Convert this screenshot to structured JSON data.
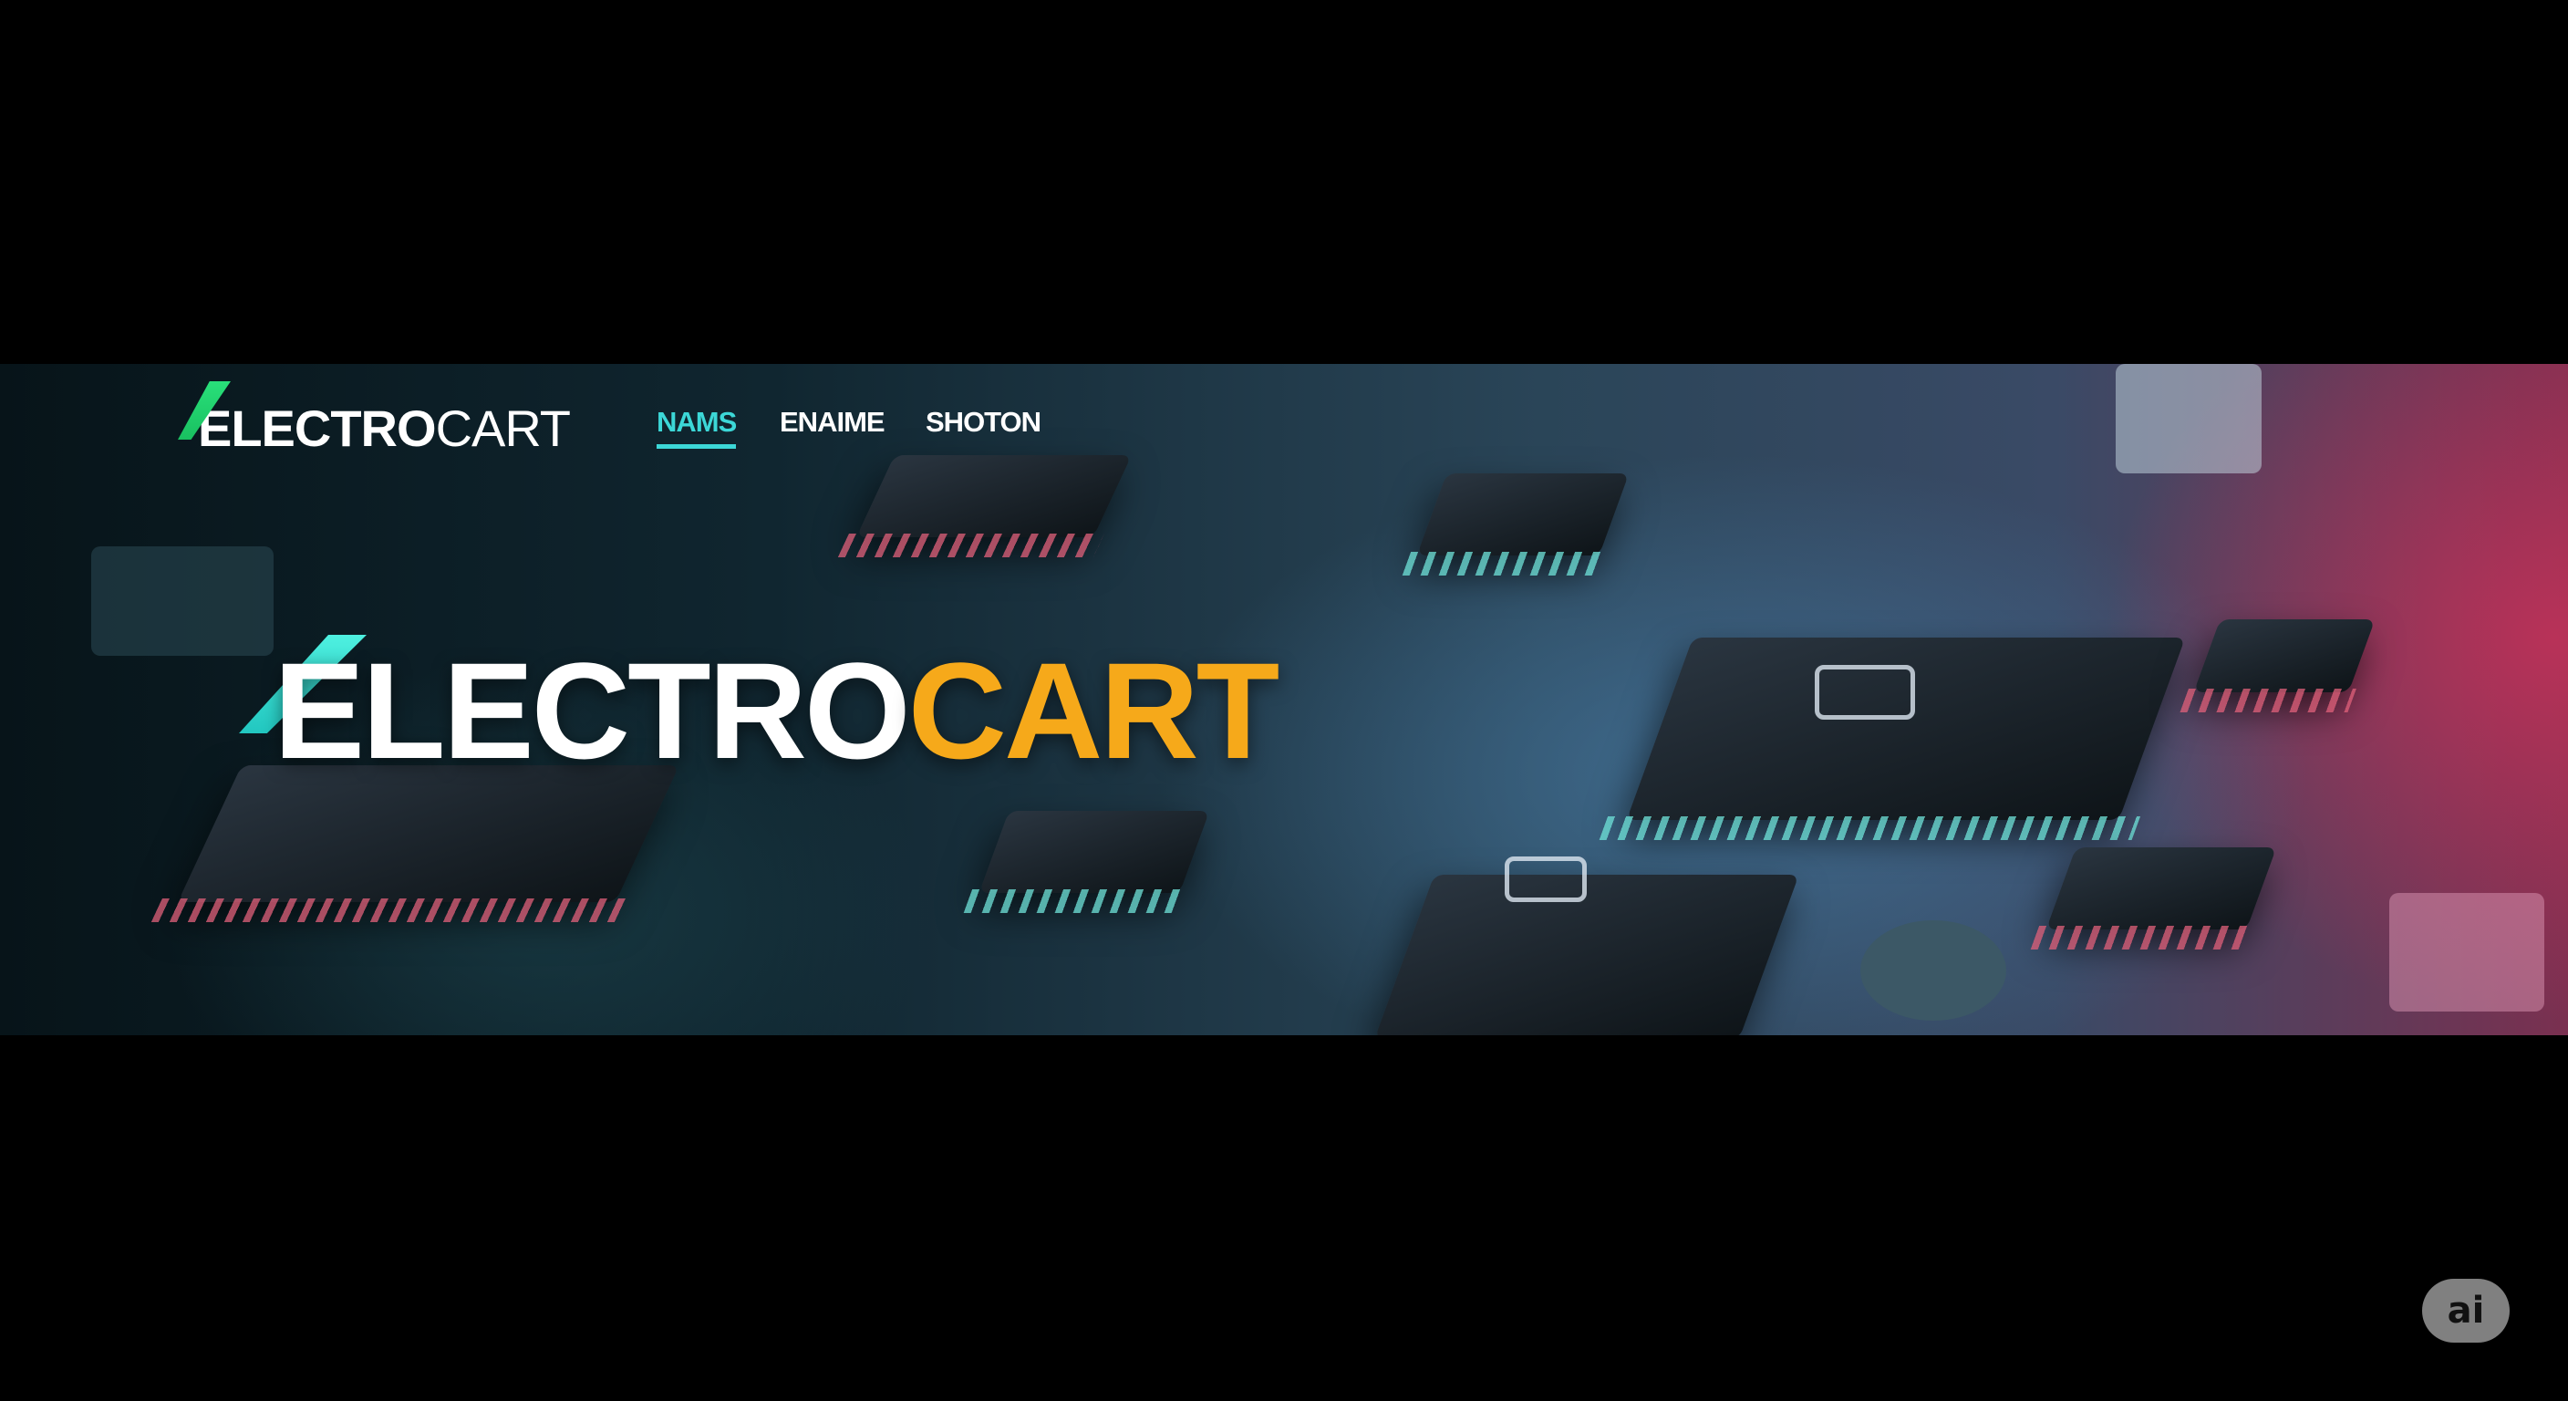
{
  "header": {
    "logo_bold": "ELECTRO",
    "logo_light": "CART",
    "nav": [
      {
        "label": "NAMS",
        "active": true
      },
      {
        "label": "ENAIME",
        "active": false
      },
      {
        "label": "SHOTON",
        "active": false
      }
    ]
  },
  "hero": {
    "title_main": "ELECTRO",
    "title_accent": "CART"
  },
  "badge": {
    "label": "ai"
  },
  "colors": {
    "accent_cyan": "#3cd7d7",
    "accent_orange": "#f6a91a",
    "logo_green": "#29e07a"
  }
}
